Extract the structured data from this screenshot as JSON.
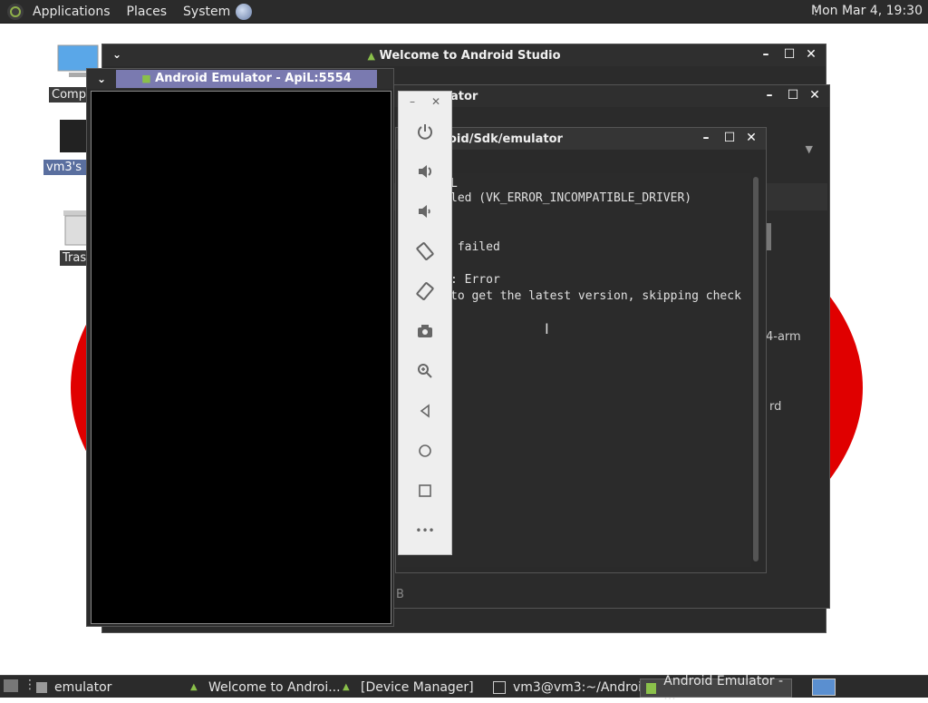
{
  "top_panel": {
    "menus": [
      "Applications",
      "Places",
      "System"
    ],
    "clock": "Mon Mar  4, 19:30"
  },
  "desktop": {
    "icons": [
      {
        "label": "Comp"
      },
      {
        "label": "vm3's h"
      },
      {
        "label": "Tras"
      }
    ]
  },
  "windows": {
    "android_studio": {
      "title": "Welcome to Android Studio"
    },
    "device_manager": {
      "title_fragment": "ator",
      "side_texts": [
        "4-arm",
        "rd"
      ],
      "status": "B"
    },
    "terminal": {
      "title_fragment": "oid/Sdk/emulator",
      "lines": [
        "L",
        "led (VK_ERROR_INCOMPATIBLE_DRIVER)",
        " failed",
        ": Error",
        "to get the latest version, skipping check"
      ]
    },
    "emulator": {
      "title": "Android Emulator - ApiL:5554"
    }
  },
  "emulator_toolbar": {
    "buttons": [
      "power-icon",
      "volume-up-icon",
      "volume-down-icon",
      "rotate-left-icon",
      "rotate-right-icon",
      "camera-icon",
      "zoom-icon",
      "back-icon",
      "home-icon",
      "overview-icon",
      "more-icon"
    ],
    "more_label": "•••"
  },
  "taskbar": {
    "items": [
      {
        "label": "emulator"
      },
      {
        "label": "Welcome to Androi..."
      },
      {
        "label": "[Device Manager]"
      },
      {
        "label": "vm3@vm3:~/Androi..."
      },
      {
        "label": "Android Emulator - ..."
      }
    ]
  },
  "colors": {
    "panel": "#2b2b2b",
    "wallpaper_red": "#e00000",
    "emulator_title": "#7a7ab0"
  }
}
